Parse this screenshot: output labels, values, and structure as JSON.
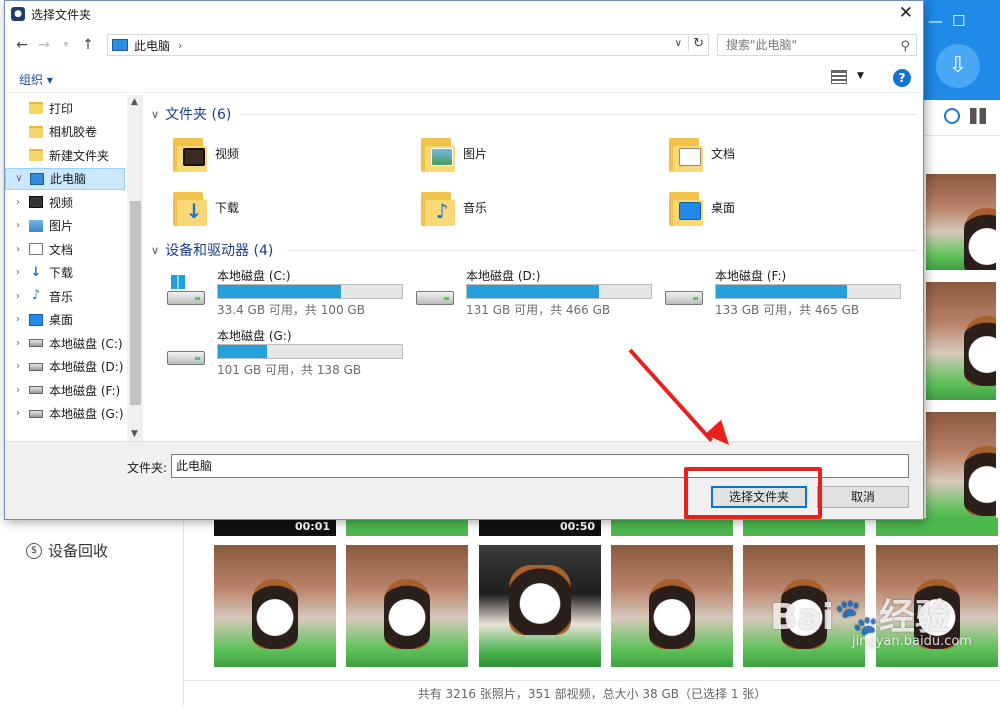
{
  "background_app": {
    "recycle_label": "设备回收",
    "footer_status": "共有 3216 张照片，351 部视频，总大小 38 GB（已选择 1 张）",
    "video_durations": [
      "00:01",
      "00:50"
    ],
    "window_buttons": {
      "minimize": "—",
      "maximize": "☐"
    },
    "download_glyph": "⇩",
    "toolbar_icons": [
      "clock-icon",
      "grid-icon"
    ]
  },
  "dialog": {
    "title": "选择文件夹",
    "close_glyph": "✕",
    "address": {
      "location": "此电脑"
    },
    "search": {
      "placeholder": "搜索\"此电脑\""
    },
    "organize_label": "组织 ▾",
    "help_glyph": "?",
    "nav_tree": [
      {
        "label": "打印",
        "icon": "folder"
      },
      {
        "label": "相机胶卷",
        "icon": "folder"
      },
      {
        "label": "新建文件夹",
        "icon": "folder"
      },
      {
        "label": "此电脑",
        "icon": "pc",
        "selected": true
      },
      {
        "label": "视频",
        "icon": "video"
      },
      {
        "label": "图片",
        "icon": "pic"
      },
      {
        "label": "文档",
        "icon": "doc"
      },
      {
        "label": "下载",
        "icon": "down"
      },
      {
        "label": "音乐",
        "icon": "music"
      },
      {
        "label": "桌面",
        "icon": "desk"
      },
      {
        "label": "本地磁盘 (C:)",
        "icon": "drive"
      },
      {
        "label": "本地磁盘 (D:)",
        "icon": "drive"
      },
      {
        "label": "本地磁盘 (F:)",
        "icon": "drive"
      },
      {
        "label": "本地磁盘 (G:)",
        "icon": "drive"
      }
    ],
    "folders_header": "文件夹 (6)",
    "folders": [
      {
        "label": "视频",
        "badge": "video"
      },
      {
        "label": "图片",
        "badge": "pic"
      },
      {
        "label": "文档",
        "badge": "doc"
      },
      {
        "label": "下载",
        "badge": "down"
      },
      {
        "label": "音乐",
        "badge": "music"
      },
      {
        "label": "桌面",
        "badge": "desk"
      }
    ],
    "drives_header": "设备和驱动器 (4)",
    "drives": [
      {
        "name": "本地磁盘 (C:)",
        "info": "33.4 GB 可用，共 100 GB",
        "used_fraction": 0.666,
        "system": true
      },
      {
        "name": "本地磁盘 (D:)",
        "info": "131 GB 可用，共 466 GB",
        "used_fraction": 0.719
      },
      {
        "name": "本地磁盘 (F:)",
        "info": "133 GB 可用，共 465 GB",
        "used_fraction": 0.714
      },
      {
        "name": "本地磁盘 (G:)",
        "info": "101 GB 可用，共 138 GB",
        "used_fraction": 0.268
      }
    ],
    "folder_label": "文件夹:",
    "folder_value": "此电脑",
    "select_button": "选择文件夹",
    "cancel_button": "取消"
  },
  "watermark": {
    "text": "Bai🐾经验",
    "sub": "jingyan.baidu.com"
  },
  "colors": {
    "accent": "#0078d7",
    "app_blue": "#1f8ae8",
    "drive_fill": "#26a0da",
    "annotation_red": "#e8211d"
  }
}
